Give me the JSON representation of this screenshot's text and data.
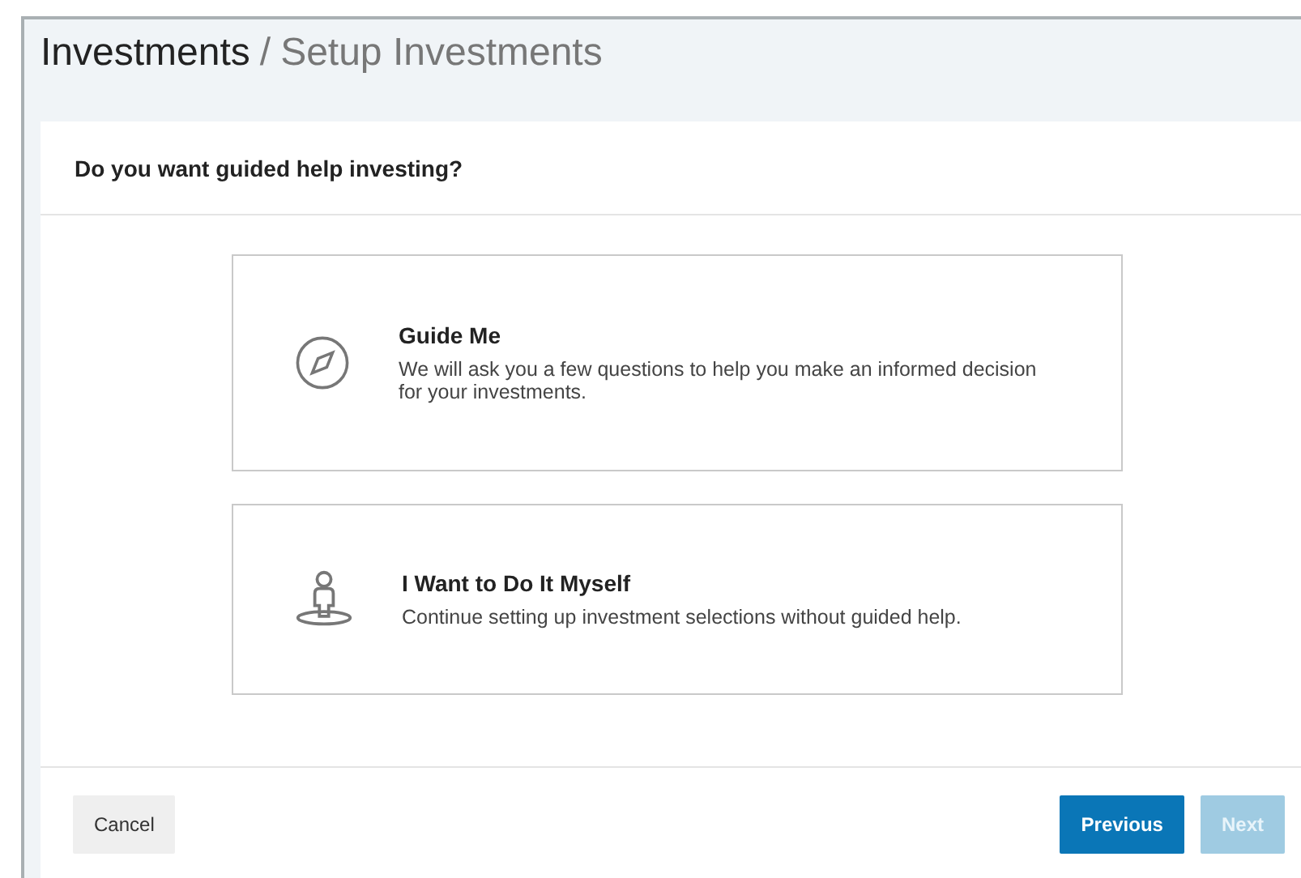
{
  "breadcrumb": {
    "section": "Investments",
    "separator": "/",
    "page": "Setup Investments"
  },
  "question": "Do you want guided help investing?",
  "options": [
    {
      "title": "Guide Me",
      "description": "We will ask you a few questions to help you make an informed decision for your investments."
    },
    {
      "title": "I Want to Do It Myself",
      "description": "Continue setting up investment selections without guided help."
    }
  ],
  "buttons": [
    {
      "label": "Cancel",
      "kind": "secondary",
      "disabled": false
    },
    {
      "label": "Previous",
      "kind": "primary",
      "disabled": false
    },
    {
      "label": "Next",
      "kind": "primary",
      "disabled": true
    }
  ]
}
